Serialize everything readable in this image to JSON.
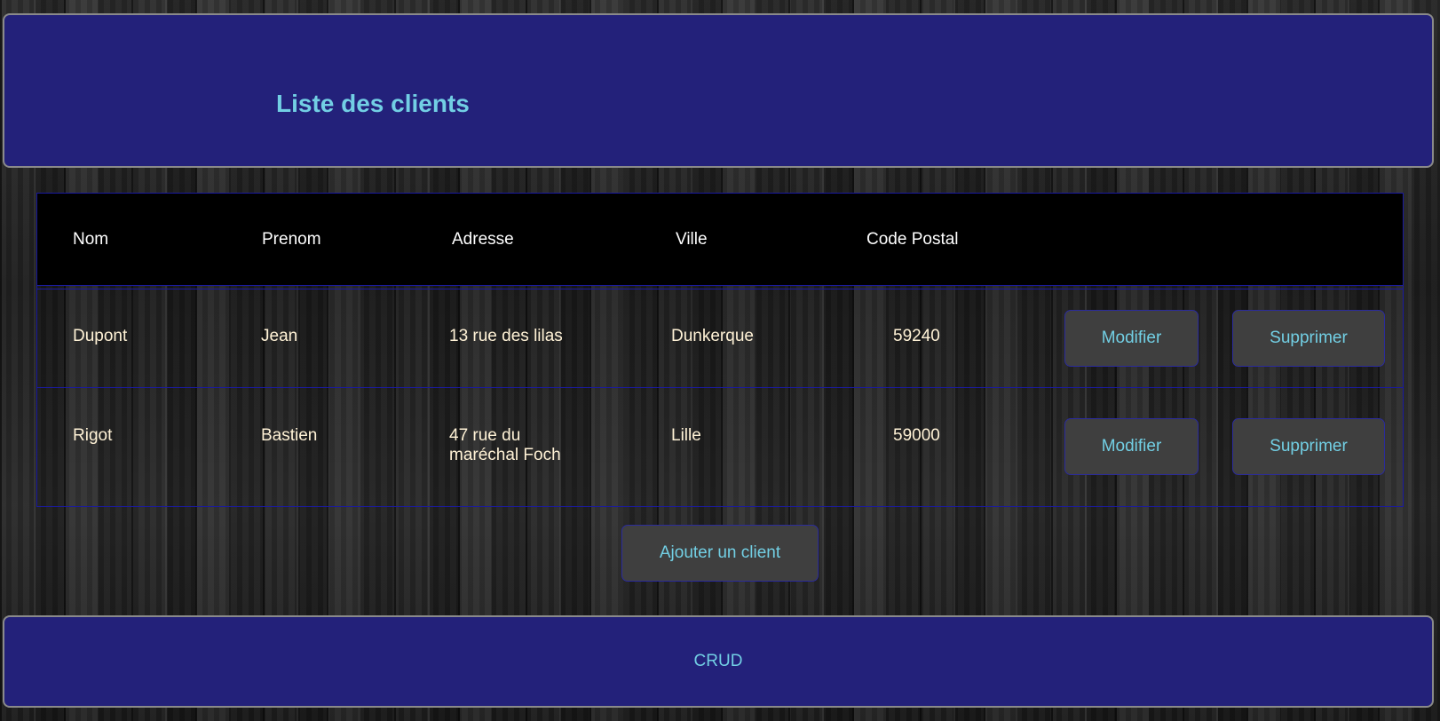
{
  "header": {
    "title": "Liste des clients"
  },
  "table": {
    "columns": [
      "Nom",
      "Prenom",
      "Adresse",
      "Ville",
      "Code Postal"
    ],
    "rows": [
      {
        "nom": "Dupont",
        "prenom": "Jean",
        "adresse": "13 rue des lilas",
        "ville": "Dunkerque",
        "code_postal": "59240",
        "modify_label": "Modifier",
        "delete_label": "Supprimer"
      },
      {
        "nom": "Rigot",
        "prenom": "Bastien",
        "adresse": "47 rue du maréchal Foch",
        "ville": "Lille",
        "code_postal": "59000",
        "modify_label": "Modifier",
        "delete_label": "Supprimer"
      }
    ]
  },
  "add_button_label": "Ajouter un client",
  "footer": {
    "text": "CRUD"
  },
  "colors": {
    "panel_background": "#23217a",
    "accent_text": "#72cfe4",
    "button_background": "#3f3f3f",
    "cell_text": "#fff2d6",
    "table_border": "#1a1aa0"
  }
}
